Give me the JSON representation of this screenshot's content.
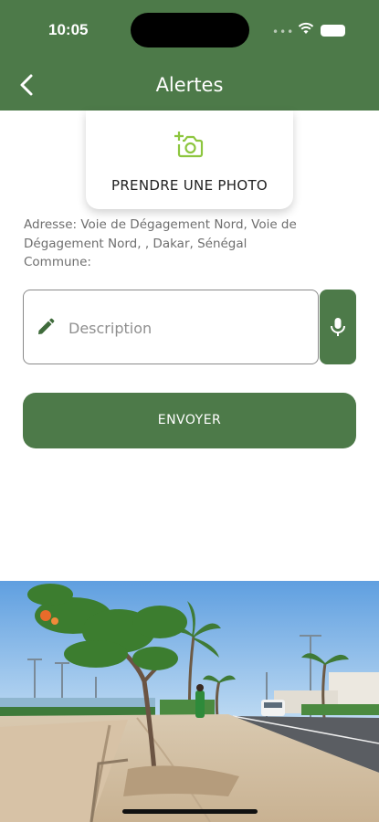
{
  "status_bar": {
    "time": "10:05",
    "dots": "•••"
  },
  "header": {
    "title": "Alertes",
    "back_icon": "chevron-left-icon"
  },
  "photo_card": {
    "label": "PRENDRE UNE PHOTO",
    "icon": "add-camera-icon"
  },
  "address": {
    "line1": "Adresse: Voie de Dégagement Nord, Voie de",
    "line2": "Dégagement Nord, , Dakar, Sénégal",
    "line3": "Commune:"
  },
  "description": {
    "placeholder": "Description",
    "value": "",
    "icon": "pencil-icon"
  },
  "mic": {
    "icon": "microphone-icon"
  },
  "send": {
    "label": "ENVOYER"
  },
  "colors": {
    "brand_green": "#4d7a49",
    "icon_green": "#8dc63f"
  }
}
